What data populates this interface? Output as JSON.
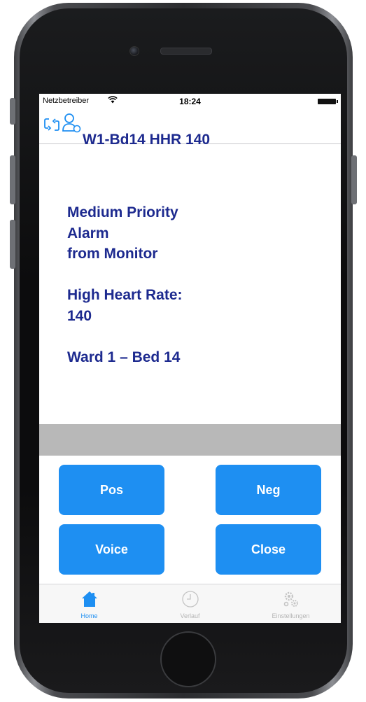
{
  "status_bar": {
    "carrier": "Netzbetreiber",
    "time": "18:24"
  },
  "nav": {
    "title": "W1-Bd14 HHR 140"
  },
  "alarm": {
    "lines": [
      "Medium Priority",
      "Alarm",
      "from Monitor",
      "",
      "High Heart Rate:",
      "140",
      "",
      "Ward 1 – Bed 14"
    ]
  },
  "actions": {
    "pos": "Pos",
    "neg": "Neg",
    "voice": "Voice",
    "close": "Close"
  },
  "tabs": [
    {
      "label": "Home",
      "icon": "home-icon",
      "active": true
    },
    {
      "label": "Verlauf",
      "icon": "clock-icon",
      "active": false
    },
    {
      "label": "Einstellungen",
      "icon": "gears-icon",
      "active": false
    }
  ],
  "colors": {
    "title_text": "#1d2a8f",
    "accent": "#1e8ff2",
    "separator_bar": "#b8b8b8"
  }
}
